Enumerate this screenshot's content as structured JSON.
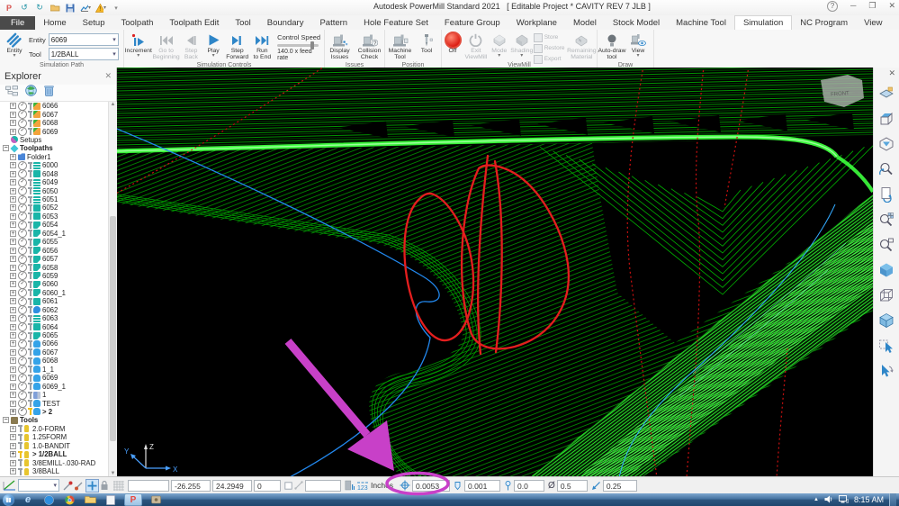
{
  "window": {
    "title_app": "Autodesk PowerMill Standard 2021",
    "title_project": "[ Editable Project * CAVITY REV 7 JLB ]"
  },
  "tabs": {
    "active": "Simulation",
    "items": [
      "File",
      "Home",
      "Setup",
      "Toolpath",
      "Toolpath Edit",
      "Tool",
      "Boundary",
      "Pattern",
      "Hole Feature Set",
      "Feature Group",
      "Workplane",
      "Model",
      "Stock Model",
      "Machine Tool",
      "Simulation",
      "NC Program",
      "View"
    ]
  },
  "ribbon": {
    "simulation_path": {
      "group_label": "Simulation Path",
      "entity_button": "Entity",
      "entity_label": "Entity",
      "entity_value": "6069",
      "tool_label": "Tool",
      "tool_value": "1/2BALL"
    },
    "simulation_controls": {
      "group_label": "Simulation Controls",
      "increment": "Increment",
      "go_to_beginning": "Go to\nBeginning",
      "step_back": "Step\nBack",
      "play": "Play",
      "step_forward": "Step\nForward",
      "run_to_end": "Run\nto End",
      "control_speed": "Control Speed",
      "feed_rate": "140.0 x feed rate"
    },
    "issues": {
      "group_label": "Issues",
      "display_issues": "Display\nIssues",
      "collision_check": "Collision\nCheck"
    },
    "position": {
      "group_label": "Position",
      "machine_tool": "Machine\nTool",
      "tool": "Tool"
    },
    "viewmill": {
      "group_label": "ViewMill",
      "off": "Off",
      "exit": "Exit\nViewMill",
      "mode": "Mode",
      "shading": "Shading",
      "store": "Store",
      "restore": "Restore",
      "export": "Export",
      "remaining": "Remaining\nMaterial"
    },
    "draw": {
      "group_label": "Draw",
      "autodraw": "Auto-draw\ntool",
      "view": "View"
    }
  },
  "explorer": {
    "title": "Explorer",
    "tree": [
      {
        "label": "6066",
        "icon": "flag",
        "indent": 1,
        "plus": true,
        "check": true,
        "pin": "gray"
      },
      {
        "label": "6067",
        "icon": "flag",
        "indent": 1,
        "plus": true,
        "check": true,
        "pin": "gray"
      },
      {
        "label": "6068",
        "icon": "flag",
        "indent": 1,
        "plus": true,
        "check": true,
        "pin": "gray"
      },
      {
        "label": "6069",
        "icon": "flag",
        "indent": 1,
        "plus": true,
        "check": true,
        "pin": "gray"
      },
      {
        "label": "Setups",
        "icon": "setups",
        "indent": 0
      },
      {
        "label": "Toolpaths",
        "icon": "diamond",
        "indent": 0,
        "bold": true,
        "expand": true
      },
      {
        "label": "Folder1",
        "icon": "folder",
        "indent": 1,
        "plus": true
      },
      {
        "label": "6000",
        "icon": "layers",
        "indent": 1,
        "plus": true,
        "check": true,
        "pin": "gray"
      },
      {
        "label": "6048",
        "icon": "box",
        "indent": 1,
        "plus": true,
        "check": true,
        "pin": "gray"
      },
      {
        "label": "6049",
        "icon": "layers",
        "indent": 1,
        "plus": true,
        "check": true,
        "pin": "gray"
      },
      {
        "label": "6050",
        "icon": "layers",
        "indent": 1,
        "plus": true,
        "check": true,
        "pin": "gray"
      },
      {
        "label": "6051",
        "icon": "layers",
        "indent": 1,
        "plus": true,
        "check": true,
        "pin": "gray"
      },
      {
        "label": "6052",
        "icon": "box",
        "indent": 1,
        "plus": true,
        "check": true,
        "pin": "gray"
      },
      {
        "label": "6053",
        "icon": "box",
        "indent": 1,
        "plus": true,
        "check": true,
        "pin": "gray"
      },
      {
        "label": "6054",
        "icon": "boxc",
        "indent": 1,
        "plus": true,
        "check": true,
        "pin": "gray"
      },
      {
        "label": "6054_1",
        "icon": "boxc",
        "indent": 1,
        "plus": true,
        "check": true,
        "pin": "gray"
      },
      {
        "label": "6055",
        "icon": "boxc",
        "indent": 1,
        "plus": true,
        "check": true,
        "pin": "gray"
      },
      {
        "label": "6056",
        "icon": "boxc",
        "indent": 1,
        "plus": true,
        "check": true,
        "pin": "gray"
      },
      {
        "label": "6057",
        "icon": "boxc",
        "indent": 1,
        "plus": true,
        "check": true,
        "pin": "gray"
      },
      {
        "label": "6058",
        "icon": "boxc",
        "indent": 1,
        "plus": true,
        "check": true,
        "pin": "gray"
      },
      {
        "label": "6059",
        "icon": "boxc",
        "indent": 1,
        "plus": true,
        "check": true,
        "pin": "gray"
      },
      {
        "label": "6060",
        "icon": "boxc",
        "indent": 1,
        "plus": true,
        "check": true,
        "pin": "gray"
      },
      {
        "label": "6060_1",
        "icon": "boxc",
        "indent": 1,
        "plus": true,
        "check": true,
        "pin": "gray"
      },
      {
        "label": "6061",
        "icon": "box",
        "indent": 1,
        "plus": true,
        "check": true,
        "pin": "gray"
      },
      {
        "label": "6062",
        "icon": "drop",
        "indent": 1,
        "plus": true,
        "check": true,
        "pin": "gray"
      },
      {
        "label": "6063",
        "icon": "layers",
        "indent": 1,
        "plus": true,
        "check": true,
        "pin": "gray"
      },
      {
        "label": "6064",
        "icon": "box",
        "indent": 1,
        "plus": true,
        "check": true,
        "pin": "gray"
      },
      {
        "label": "6065",
        "icon": "boxc",
        "indent": 1,
        "plus": true,
        "check": true,
        "pin": "gray"
      },
      {
        "label": "6066",
        "icon": "cyl",
        "indent": 1,
        "plus": true,
        "check": true,
        "pin": "gray"
      },
      {
        "label": "6067",
        "icon": "cyl",
        "indent": 1,
        "plus": true,
        "check": true,
        "pin": "gray"
      },
      {
        "label": "6068",
        "icon": "cyl",
        "indent": 1,
        "plus": true,
        "check": true,
        "pin": "gray"
      },
      {
        "label": "1_1",
        "icon": "cyl",
        "indent": 1,
        "plus": true,
        "check": true,
        "pin": "gray"
      },
      {
        "label": "6069",
        "icon": "cyl",
        "indent": 1,
        "plus": true,
        "check": true,
        "pin": "gray"
      },
      {
        "label": "6069_1",
        "icon": "cyl",
        "indent": 1,
        "plus": true,
        "check": true,
        "pin": "gray"
      },
      {
        "label": "1",
        "icon": "special",
        "indent": 1,
        "plus": true,
        "check": true,
        "pin": "gray"
      },
      {
        "label": "TEST",
        "icon": "cyl",
        "indent": 1,
        "plus": true,
        "check": true,
        "pin": "gray"
      },
      {
        "label": "> 2",
        "icon": "cyl",
        "indent": 1,
        "plus": true,
        "check": true,
        "pin": "yellow",
        "bold": true
      },
      {
        "label": "Tools",
        "icon": "toolsgrp",
        "indent": 0,
        "bold": true,
        "expand": true
      },
      {
        "label": "2.0-FORM",
        "icon": "tool",
        "indent": 1,
        "plus": true,
        "pin": "gray"
      },
      {
        "label": "1.25FORM",
        "icon": "tool",
        "indent": 1,
        "plus": true,
        "pin": "gray"
      },
      {
        "label": "1.0-BANDIT",
        "icon": "tool",
        "indent": 1,
        "plus": true,
        "pin": "gray"
      },
      {
        "label": "> 1/2BALL",
        "icon": "tool",
        "indent": 1,
        "plus": true,
        "pin": "yellow",
        "bold": true
      },
      {
        "label": "3/8EMILL-.030-RAD",
        "icon": "tool",
        "indent": 1,
        "plus": true,
        "pin": "gray"
      },
      {
        "label": "3/8BALL",
        "icon": "tool",
        "indent": 1,
        "plus": true,
        "pin": "gray"
      }
    ]
  },
  "icon_colors": {
    "flag": "#f2a33c",
    "flag2": "#3cb43c",
    "teal": "#1ab5a8",
    "blue_cyl": "#35a3e8",
    "drop": "#2e8fe0",
    "folder": "#4a86d8",
    "diamond": "#3fc6d8",
    "tool_yellow": "#e7c52e",
    "tools_group": "#8a7a50",
    "setups": "#c060c0",
    "special": "#7f9fd8",
    "pin_gray": "#9aa0a6",
    "pin_yellow": "#f0c020"
  },
  "viewport": {
    "viewcube_label": "FRONT",
    "axis": {
      "x": "X",
      "y": "Y",
      "z": "Z"
    }
  },
  "statusbar": {
    "x": "-26.255",
    "y": "24.2949",
    "z": "0",
    "units": "Inches",
    "cursor_value": "0.0053",
    "tolerance": "0.001",
    "thickness": "0.0",
    "diameter_symbol": "Ø",
    "diameter": "0.5",
    "stepdown": "0.25"
  },
  "taskbar": {
    "time": "8:15 AM"
  },
  "colors": {
    "accent_blue": "#2f86c8",
    "magenta": "#c840c8",
    "toolpath_green": "#00b400",
    "bright_green": "#3dff3d",
    "off_red": "#dd2015",
    "scribble_red": "#e41e1e",
    "curve_blue": "#2288ee"
  }
}
